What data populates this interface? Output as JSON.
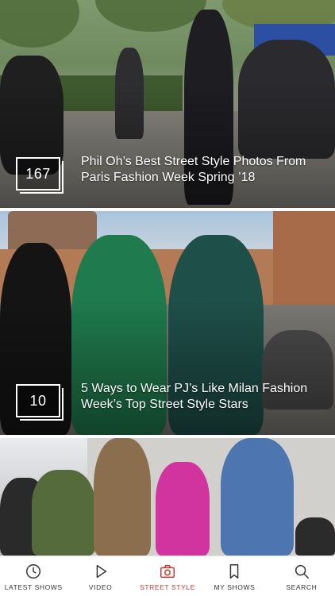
{
  "feed": {
    "cards": [
      {
        "count": "167",
        "title": "Phil Oh’s Best Street Style Photos From Paris Fashion Week Spring ’18"
      },
      {
        "count": "10",
        "title": "5 Ways to Wear PJ’s Like Milan Fashion Week’s Top Street Style Stars"
      },
      {
        "count": "",
        "title": ""
      }
    ]
  },
  "tabbar": {
    "tabs": [
      {
        "label": "LATEST SHOWS",
        "icon": "clock-icon"
      },
      {
        "label": "VIDEO",
        "icon": "play-icon"
      },
      {
        "label": "STREET STYLE",
        "icon": "camera-icon",
        "active": true
      },
      {
        "label": "MY SHOWS",
        "icon": "bookmark-icon"
      },
      {
        "label": "SEARCH",
        "icon": "search-icon"
      }
    ]
  },
  "colors": {
    "active": "#c0392b",
    "inactive": "#333333"
  }
}
